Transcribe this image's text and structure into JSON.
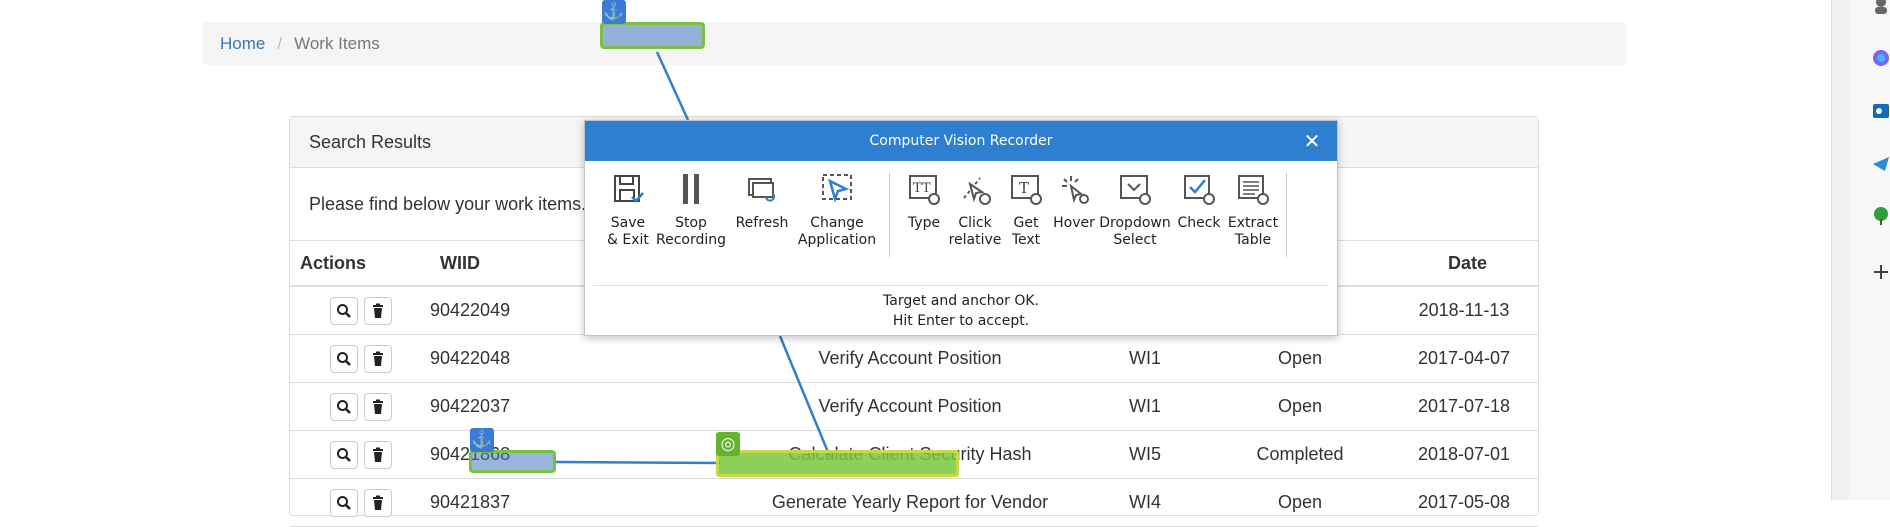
{
  "breadcrumb": {
    "home": "Home",
    "separator": "/",
    "current": "Work Items"
  },
  "panel": {
    "heading": "Search Results",
    "intro": "Please find below your work items."
  },
  "table": {
    "headers": {
      "actions": "Actions",
      "wiid": "WIID",
      "description": "",
      "type": "",
      "status": "",
      "date": "Date"
    },
    "rows": [
      {
        "wiid": "90422049",
        "description": "",
        "type": "",
        "status": "",
        "date": "2018-11-13"
      },
      {
        "wiid": "90422048",
        "description": "Verify Account Position",
        "type": "WI1",
        "status": "Open",
        "date": "2017-04-07"
      },
      {
        "wiid": "90422037",
        "description": "Verify Account Position",
        "type": "WI1",
        "status": "Open",
        "date": "2017-07-18"
      },
      {
        "wiid": "90421868",
        "description": "Calculate Client Security Hash",
        "type": "WI5",
        "status": "Completed",
        "date": "2018-07-01"
      },
      {
        "wiid": "90421837",
        "description": "Generate Yearly Report for Vendor",
        "type": "WI4",
        "status": "Open",
        "date": "2017-05-08"
      }
    ]
  },
  "recorder": {
    "title": "Computer Vision Recorder",
    "tools": [
      {
        "label": "Save\n& Exit",
        "icon": "save-icon"
      },
      {
        "label": "Stop\nRecording",
        "icon": "pause-icon"
      },
      {
        "label": "Refresh",
        "icon": "refresh-icon"
      },
      {
        "label": "Change\nApplication",
        "icon": "cursor-select-icon"
      },
      {
        "label": "Type",
        "icon": "type-icon"
      },
      {
        "label": "Click\nrelative",
        "icon": "click-relative-icon"
      },
      {
        "label": "Get\nText",
        "icon": "get-text-icon"
      },
      {
        "label": "Hover",
        "icon": "hover-icon"
      },
      {
        "label": "Dropdown\nSelect",
        "icon": "dropdown-select-icon"
      },
      {
        "label": "Check",
        "icon": "check-icon"
      },
      {
        "label": "Extract\nTable",
        "icon": "extract-table-icon"
      }
    ],
    "message": "Target and anchor OK.\nHit Enter to accept."
  },
  "colors": {
    "link": "#337ab7",
    "recorder_title_bg": "#2f7fd0",
    "anchor_blue": "#3a7bd5",
    "target_green": "#66b32e"
  }
}
